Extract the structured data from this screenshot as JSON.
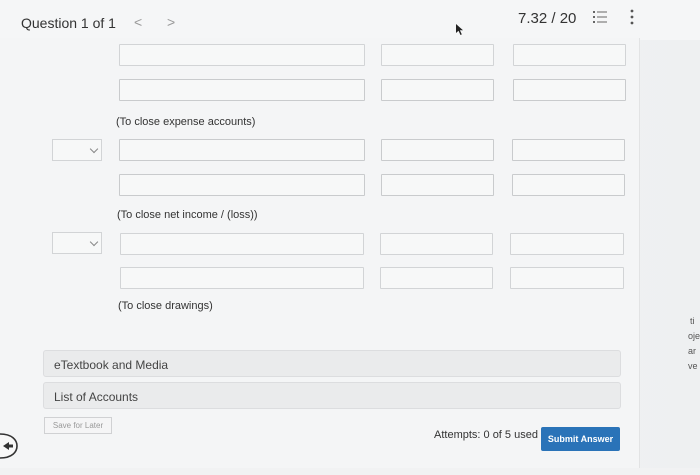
{
  "header": {
    "question_label": "Question 1 of 1",
    "prev_icon": "<",
    "next_icon": ">",
    "score": "7.32 / 20",
    "list_icon": "list-icon",
    "more_icon": "more-vertical-icon"
  },
  "notes": {
    "close_expense": "(To close expense accounts)",
    "close_net_income": "(To close net income / (loss))",
    "close_drawings": "(To close drawings)"
  },
  "links": {
    "etextbook": "eTextbook and Media",
    "accounts": "List of Accounts"
  },
  "footer": {
    "save_label": "Save for Later",
    "attempts": "Attempts: 0 of 5 used",
    "submit_label": "Submit Answer"
  },
  "edge_fragments": [
    "ti",
    "oje",
    "ar",
    "ve"
  ],
  "colors": {
    "submit_bg": "#2a73b8",
    "background": "#f4f5f6",
    "field_border": "#d2d4d6"
  }
}
